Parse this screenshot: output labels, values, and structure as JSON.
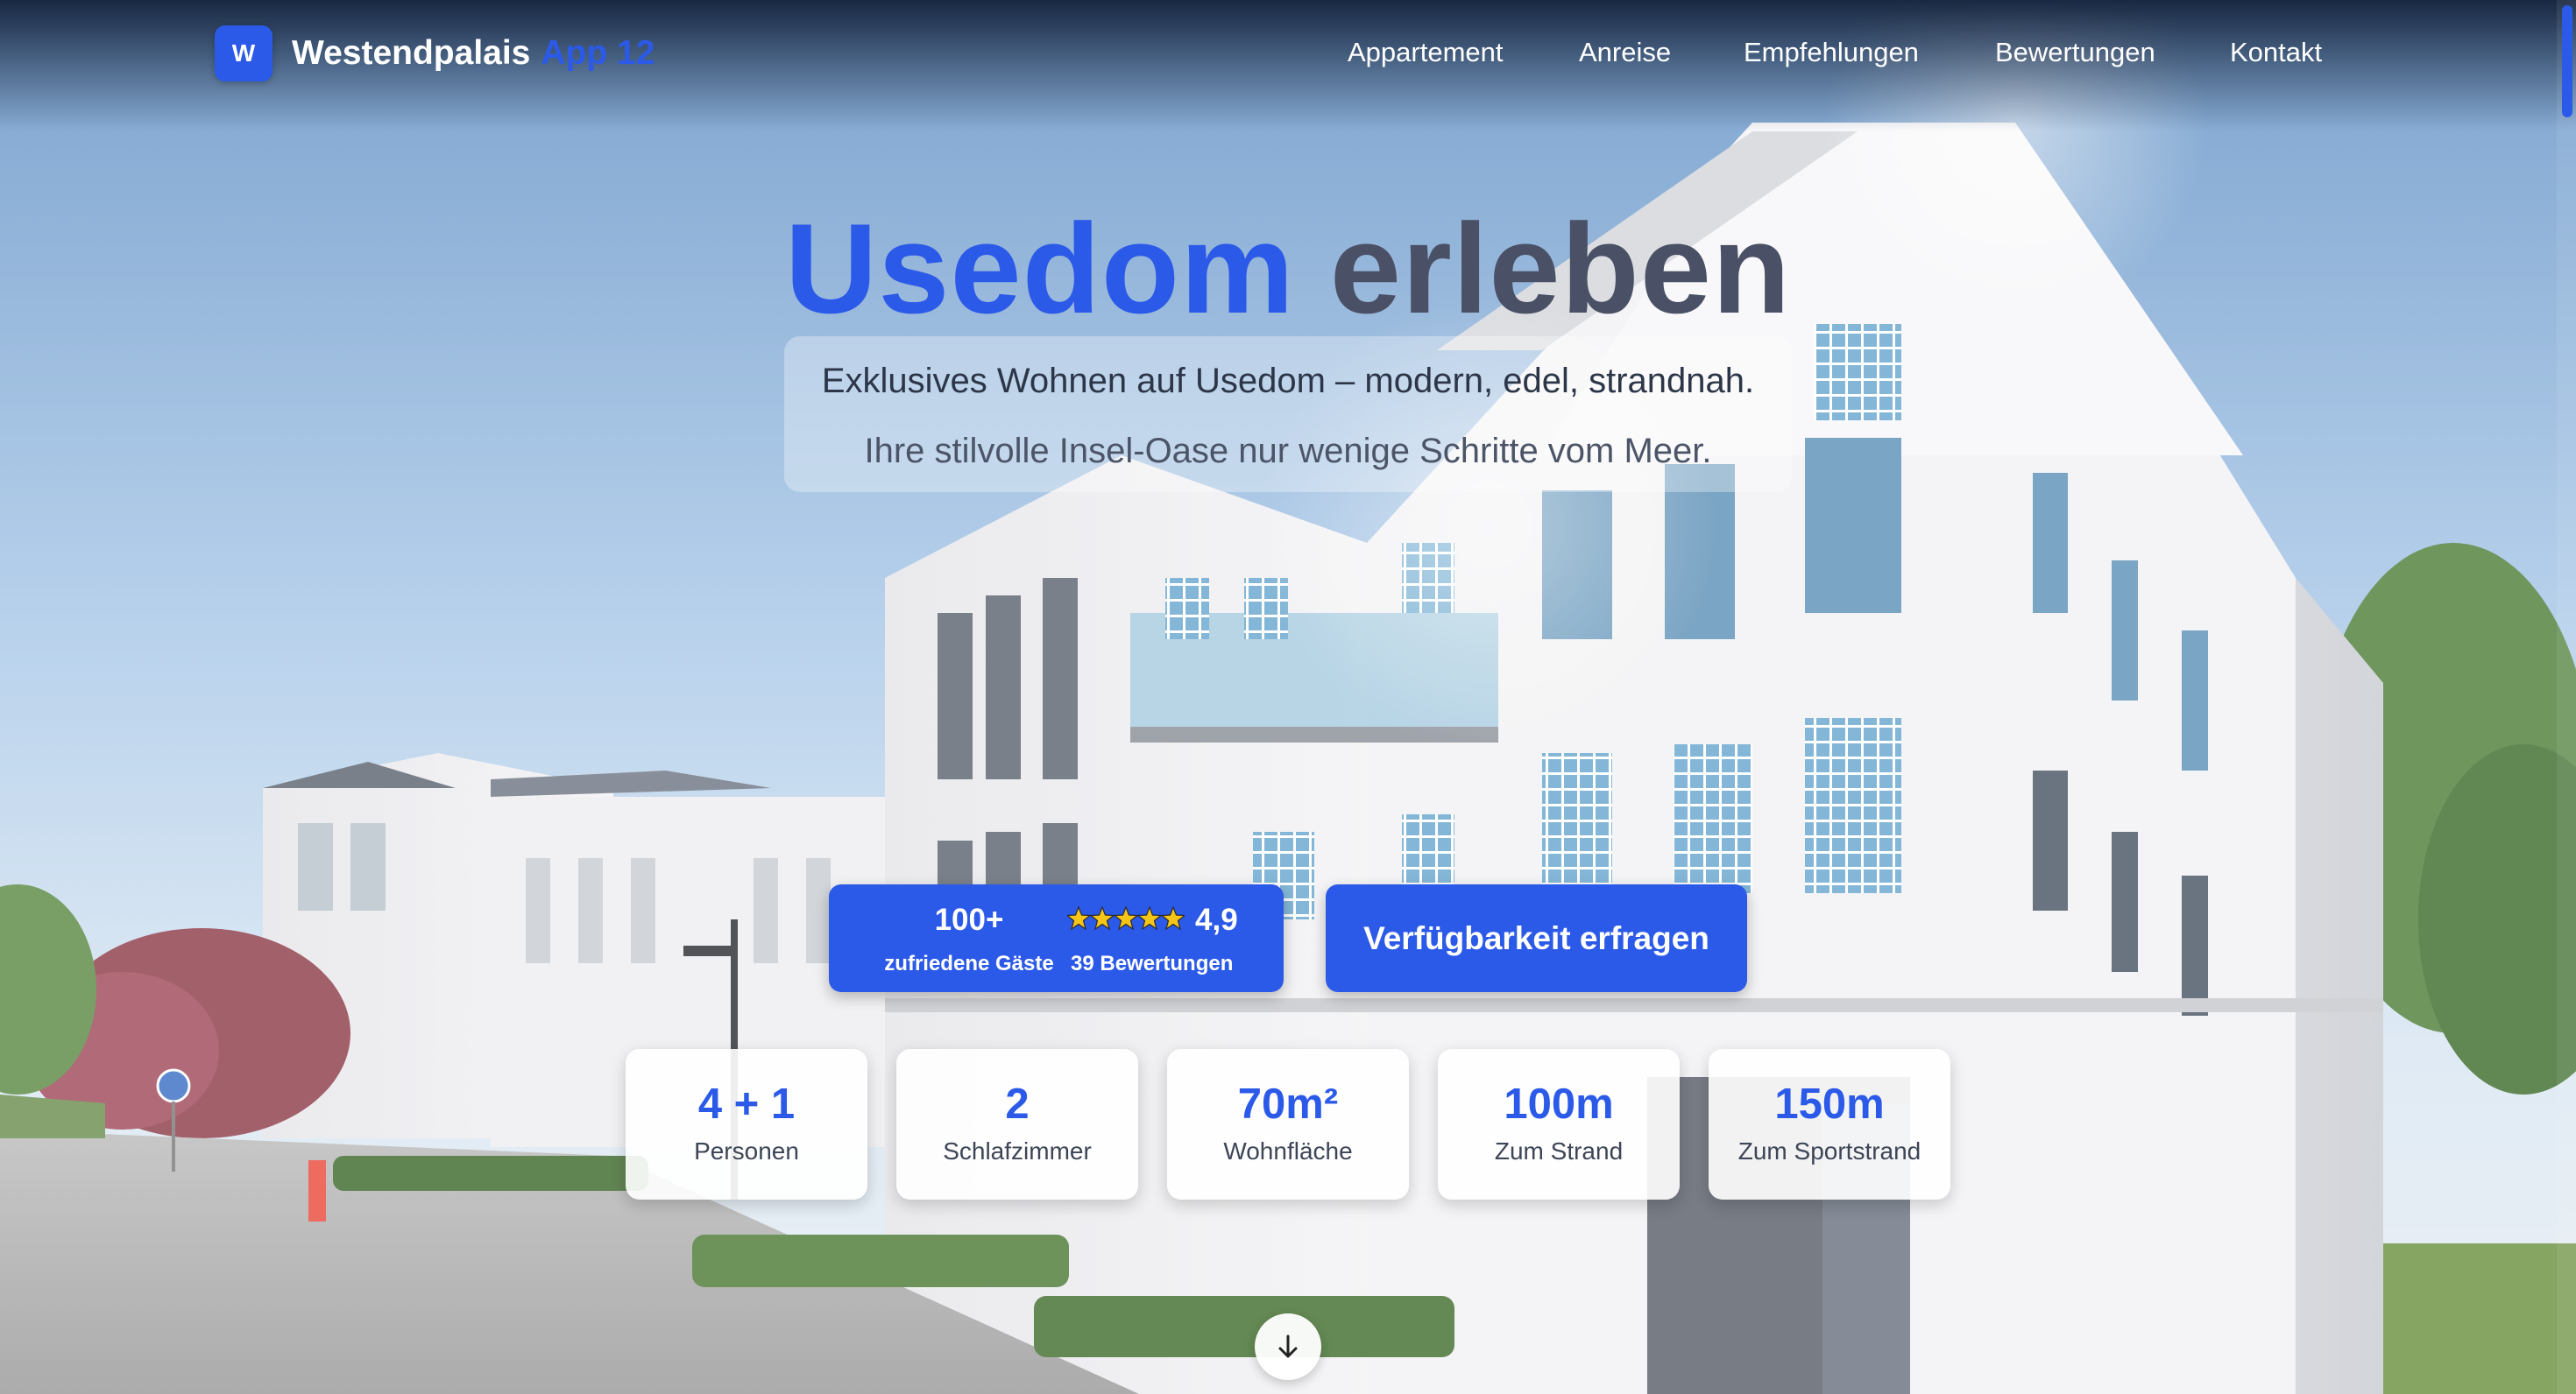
{
  "nav": {
    "logo_letter": "W",
    "brand_name": "Westendpalais",
    "brand_suffix": "App 12",
    "links": [
      "Appartement",
      "Anreise",
      "Empfehlungen",
      "Bewertungen",
      "Kontakt"
    ]
  },
  "hero": {
    "headline_word1": "Usedom",
    "headline_word2": "erleben",
    "subtitle_1": "Exklusives Wohnen auf Usedom – modern, edel, strandnah.",
    "subtitle_2": "Ihre stilvolle Insel-Oase nur wenige Schritte vom Meer.",
    "background": "hero-photo-white-villa-apartment-building"
  },
  "rating": {
    "guests_count": "100+",
    "guests_label": "zufriedene Gäste",
    "stars": 5,
    "rating_value": "4,9",
    "reviews_label": "39 Bewertungen"
  },
  "cta": {
    "label": "Verfügbarkeit erfragen"
  },
  "stats": [
    {
      "value": "4 + 1",
      "label": "Personen"
    },
    {
      "value": "2",
      "label": "Schlafzimmer"
    },
    {
      "value": "70m²",
      "label": "Wohnfläche"
    },
    {
      "value": "100m",
      "label": "Zum Strand"
    },
    {
      "value": "150m",
      "label": "Zum Sportstrand"
    }
  ],
  "icons": {
    "scroll_down": "arrow-down-icon",
    "stars": "star-icon"
  },
  "colors": {
    "accent": "#2c5ae8",
    "headline_dark": "#4a5065",
    "stat_label": "#3d4556",
    "star": "#f5c518"
  }
}
